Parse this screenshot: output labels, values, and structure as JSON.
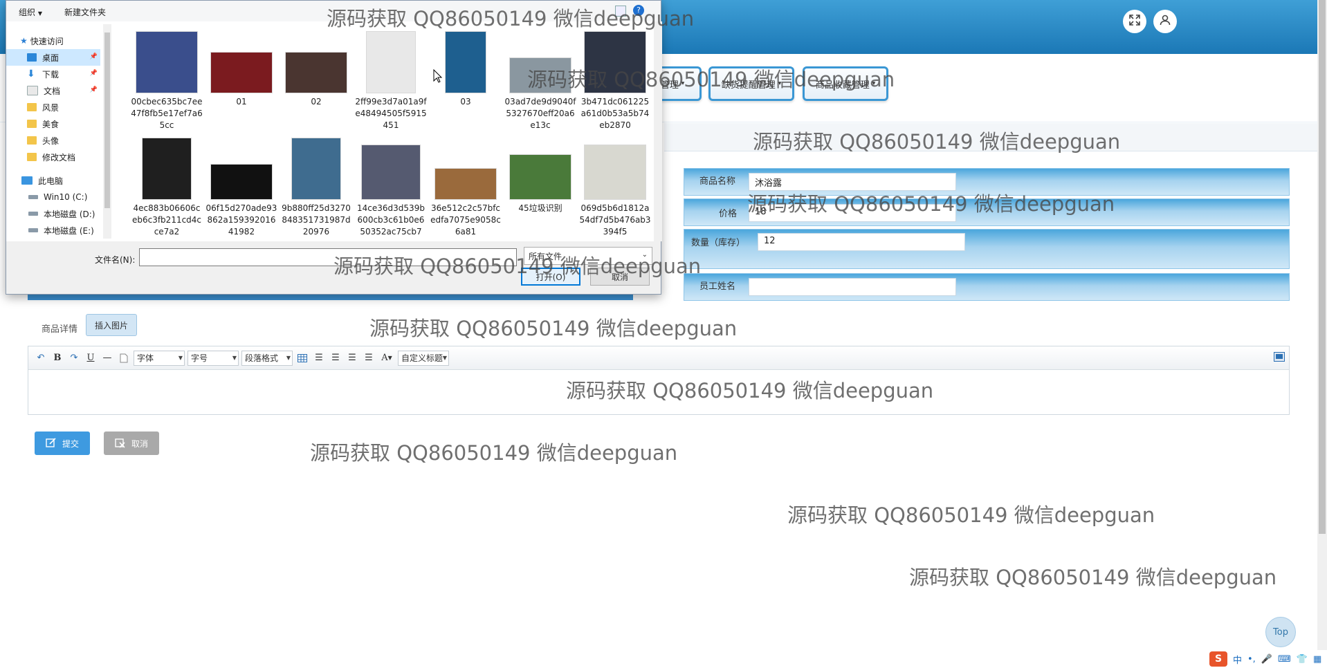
{
  "header": {
    "fullscreen_icon": "expand-icon",
    "user_icon": "user-icon",
    "gradient_colors": [
      "#3f9fd6",
      "#1b78b6"
    ]
  },
  "nav": {
    "items": [
      "管理",
      "缺货提醒管理",
      "商品收藏管理"
    ]
  },
  "form": {
    "fields": [
      {
        "label": "商品名称",
        "value": "沐浴露"
      },
      {
        "label": "价格",
        "value": "18"
      },
      {
        "label": "数量（库存）",
        "value": "12"
      },
      {
        "label": "员工姓名",
        "value": ""
      }
    ],
    "detail_label": "商品详情",
    "insert_image_label": "插入图片",
    "submit_label": "提交",
    "cancel_label": "取消"
  },
  "editor": {
    "font_select": "字体",
    "size_select": "字号",
    "paragraph_select": "段落格式",
    "custom_title_select": "自定义标题",
    "bold": "B",
    "underline": "U",
    "font_color": "A"
  },
  "dialog": {
    "toolbar": {
      "organize": "组织",
      "new_folder": "新建文件夹",
      "help": "?"
    },
    "nav": {
      "quick_access": "快速访问",
      "items": [
        {
          "label": "桌面",
          "icon": "desktop-icon",
          "selected": true,
          "pinned": true
        },
        {
          "label": "下载",
          "icon": "download-icon",
          "selected": false,
          "pinned": true
        },
        {
          "label": "文档",
          "icon": "document-icon",
          "selected": false,
          "pinned": true
        },
        {
          "label": "风景",
          "icon": "folder-icon",
          "selected": false,
          "pinned": false
        },
        {
          "label": "美食",
          "icon": "folder-icon",
          "selected": false,
          "pinned": false
        },
        {
          "label": "头像",
          "icon": "folder-icon",
          "selected": false,
          "pinned": false
        },
        {
          "label": "修改文档",
          "icon": "folder-icon",
          "selected": false,
          "pinned": false
        }
      ],
      "this_pc": "此电脑",
      "drives": [
        "Win10 (C:)",
        "本地磁盘 (D:)",
        "本地磁盘 (E:)"
      ]
    },
    "files": [
      {
        "name": "00cbec635bc7ee47f8fb5e17ef7a65cc",
        "thumb_color": "#3a4e8c"
      },
      {
        "name": "01",
        "thumb_color": "#7b1b1f"
      },
      {
        "name": "02",
        "thumb_color": "#4a3530"
      },
      {
        "name": "2ff99e3d7a01a9fe48494505f5915451",
        "thumb_color": "#e8e8e8"
      },
      {
        "name": "03",
        "thumb_color": "#1e5f8f"
      },
      {
        "name": "03ad7de9d9040f5327670eff20a6e13c",
        "thumb_color": "#8a97a0"
      },
      {
        "name": "3b471dc061225a61d0b53a5b74eb2870",
        "thumb_color": "#2d3444"
      },
      {
        "name": "4ec883b06606ceb6c3fb211cd4cce7a2",
        "thumb_color": "#1f1f1f"
      },
      {
        "name": "06f15d270ade93862a15939201641982",
        "thumb_color": "#111111"
      },
      {
        "name": "9b880ff25d3270848351731987d20976",
        "thumb_color": "#3f6c8f"
      },
      {
        "name": "14ce36d3d539b600cb3c61b0e650352ac75cb7",
        "thumb_color": "#555a70"
      },
      {
        "name": "36e512c2c57bfcedfa7075e9058c6a81",
        "thumb_color": "#9a6a3c"
      },
      {
        "name": "45垃圾识别",
        "thumb_color": "#4a7a3a"
      },
      {
        "name": "069d5b6d1812a54df7d5b476ab3394f5",
        "thumb_color": "#d8d8d0"
      }
    ],
    "filename_label": "文件名(N):",
    "filename_value": "",
    "filter_label": "所有文件",
    "open_label": "打开(O)",
    "cancel_label": "取消"
  },
  "top_button": "Top",
  "ime": {
    "logo": "S",
    "mode": "中",
    "punct": "•,"
  },
  "watermark": "源码获取 QQ86050149 微信deepguan"
}
